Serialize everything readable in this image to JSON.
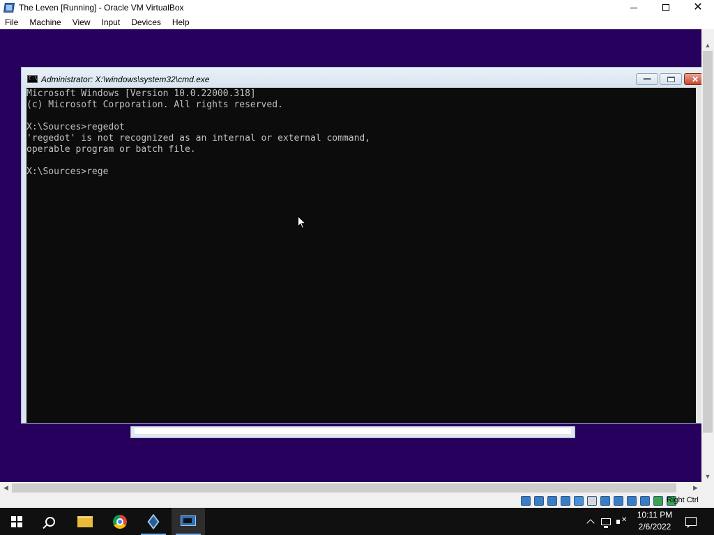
{
  "host_window": {
    "title": "The Leven [Running] - Oracle VM VirtualBox",
    "minimize_glyph": "minimize-icon",
    "maximize_glyph": "maximize-icon",
    "close_glyph": "✕"
  },
  "menu": {
    "items": [
      "File",
      "Machine",
      "View",
      "Input",
      "Devices",
      "Help"
    ]
  },
  "guest": {
    "background_color": "#26005c",
    "cmd": {
      "title": "Administrator: X:\\windows\\system32\\cmd.exe",
      "icon_text": "C:\\",
      "lines": [
        "Microsoft Windows [Version 10.0.22000.318]",
        "(c) Microsoft Corporation. All rights reserved.",
        "",
        "X:\\Sources>regedot",
        "'regedot' is not recognized as an internal or external command,",
        "operable program or batch file.",
        "",
        "X:\\Sources>rege"
      ]
    }
  },
  "status_bar": {
    "icons": [
      "hard-disk-icon",
      "optical-drive-icon",
      "audio-icon",
      "network-icon",
      "usb-icon",
      "shared-folders-icon",
      "display-icon",
      "recording-icon",
      "cpu-icon",
      "vt-x-icon",
      "mouse-integration-icon",
      "keyboard-icon"
    ],
    "icon_colors": [
      "#3b7dc4",
      "#3b7dc4",
      "#3b7dc4",
      "#3b7dc4",
      "#4a8fd6",
      "#d6d6d6",
      "#3b7dc4",
      "#3b7dc4",
      "#3b7dc4",
      "#3b7dc4",
      "#3ca34a",
      "#3ca34a"
    ],
    "host_key": "Right Ctrl"
  },
  "taskbar": {
    "apps": [
      "start-button",
      "search-button",
      "file-explorer",
      "google-chrome",
      "virtualbox-manager",
      "the-leven-vm"
    ],
    "clock_time": "10:11 PM",
    "clock_date": "2/6/2022"
  }
}
